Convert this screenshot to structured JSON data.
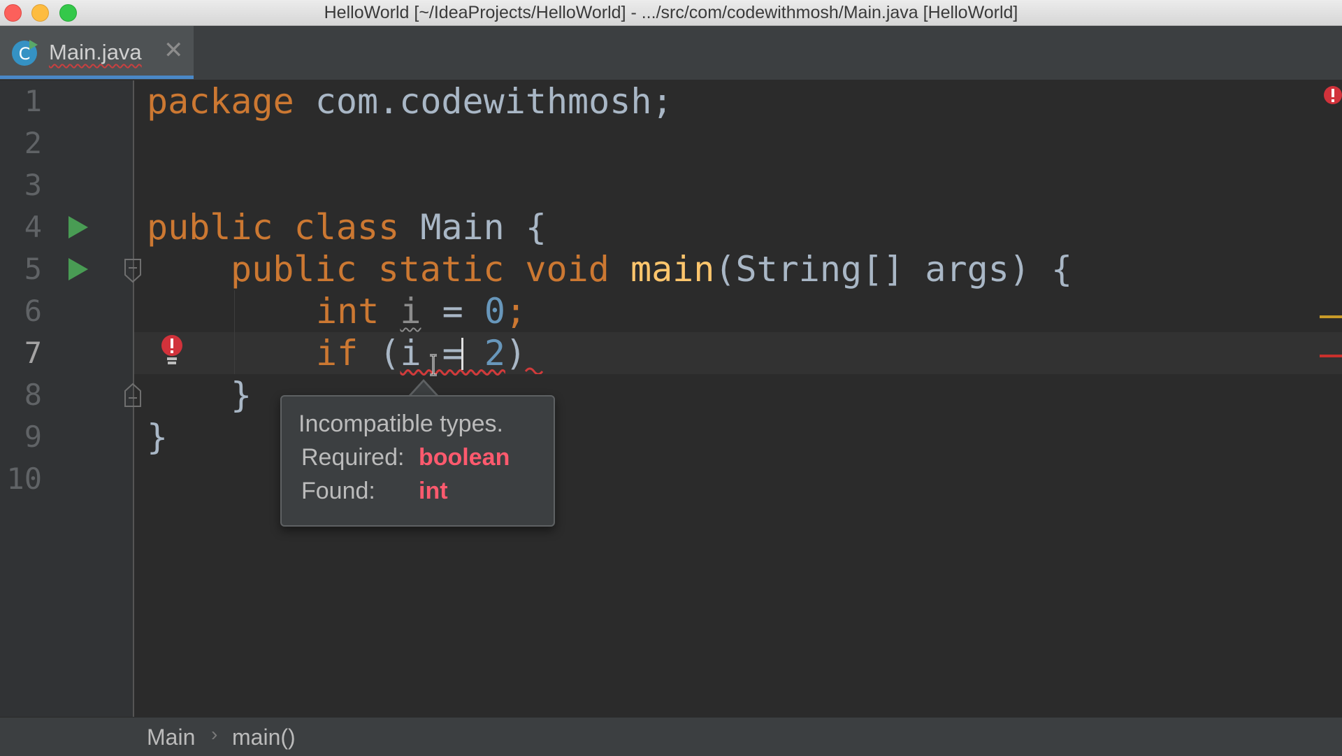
{
  "window": {
    "title": "HelloWorld [~/IdeaProjects/HelloWorld] - .../src/com/codewithmosh/Main.java [HelloWorld]"
  },
  "tabs": [
    {
      "label": "Main.java",
      "icon": "java-class-icon",
      "close": "✕",
      "active": true
    }
  ],
  "gutter": {
    "line_numbers": [
      "1",
      "2",
      "3",
      "4",
      "5",
      "6",
      "7",
      "8",
      "9",
      "10"
    ],
    "current_line": "7"
  },
  "code": {
    "l1_kw": "package",
    "l1_rest": " com.codewithmosh;",
    "l4_kw": "public class",
    "l4_rest": " Main {",
    "l5_kw1": "public static void",
    "l5_fn": " main",
    "l5_rest": "(String[] args) {",
    "l6_kw": "int",
    "l6_var": "i",
    "l6_eq": " = ",
    "l6_num": "0",
    "l6_end": ";",
    "l7_kw": "if",
    "l7_open": " (",
    "l7_expr": "i = ",
    "l7_num": "2",
    "l7_close": ")",
    "l8": "}",
    "l9": "}"
  },
  "tooltip": {
    "title": "Incompatible types.",
    "required_label": "Required:",
    "required_value": "boolean",
    "found_label": "Found:",
    "found_value": "int"
  },
  "breadcrumb": {
    "items": [
      "Main",
      "main()"
    ],
    "separator": "›"
  },
  "colors": {
    "keyword": "#cc7832",
    "number": "#6897bb",
    "function": "#ffc66d",
    "plain": "#a9b7c6",
    "error": "#ff5a6e",
    "accent": "#4a88c7"
  }
}
